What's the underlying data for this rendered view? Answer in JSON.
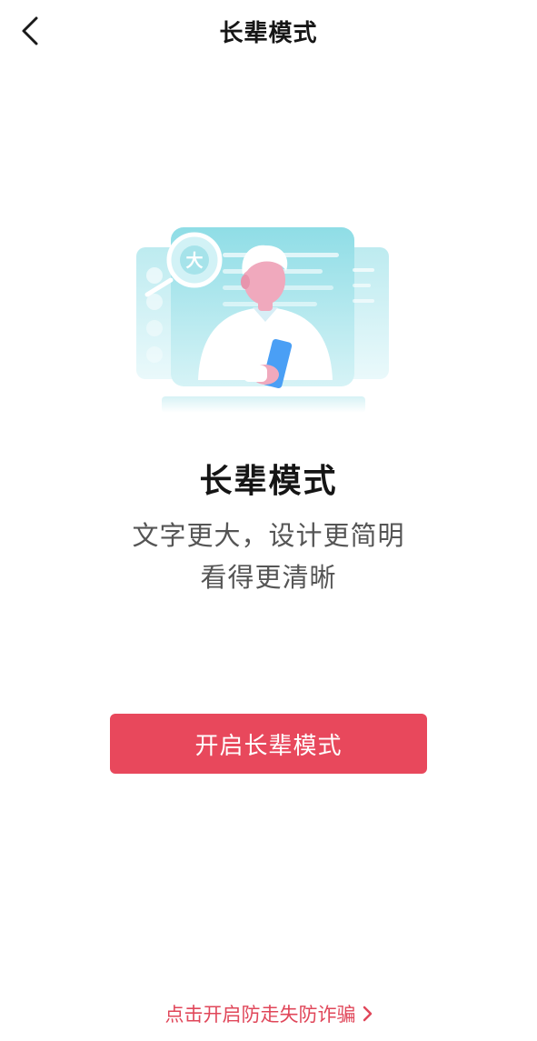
{
  "nav": {
    "title": "长辈模式",
    "back_icon": "chevron-left-icon"
  },
  "hero": {
    "badge_char": "大",
    "title": "长辈模式",
    "desc_line_1": "文字更大，设计更简明",
    "desc_line_2": "看得更清晰"
  },
  "actions": {
    "enable_label": "开启长辈模式"
  },
  "footer": {
    "link_text": "点击开启防走失防诈骗",
    "link_icon": "chevron-right-icon"
  },
  "colors": {
    "accent": "#e8485c",
    "link": "#e0475a",
    "illustration_teal": "#8fdde6",
    "illustration_pink": "#f0a9bd",
    "phone_blue": "#4a9ff5"
  }
}
